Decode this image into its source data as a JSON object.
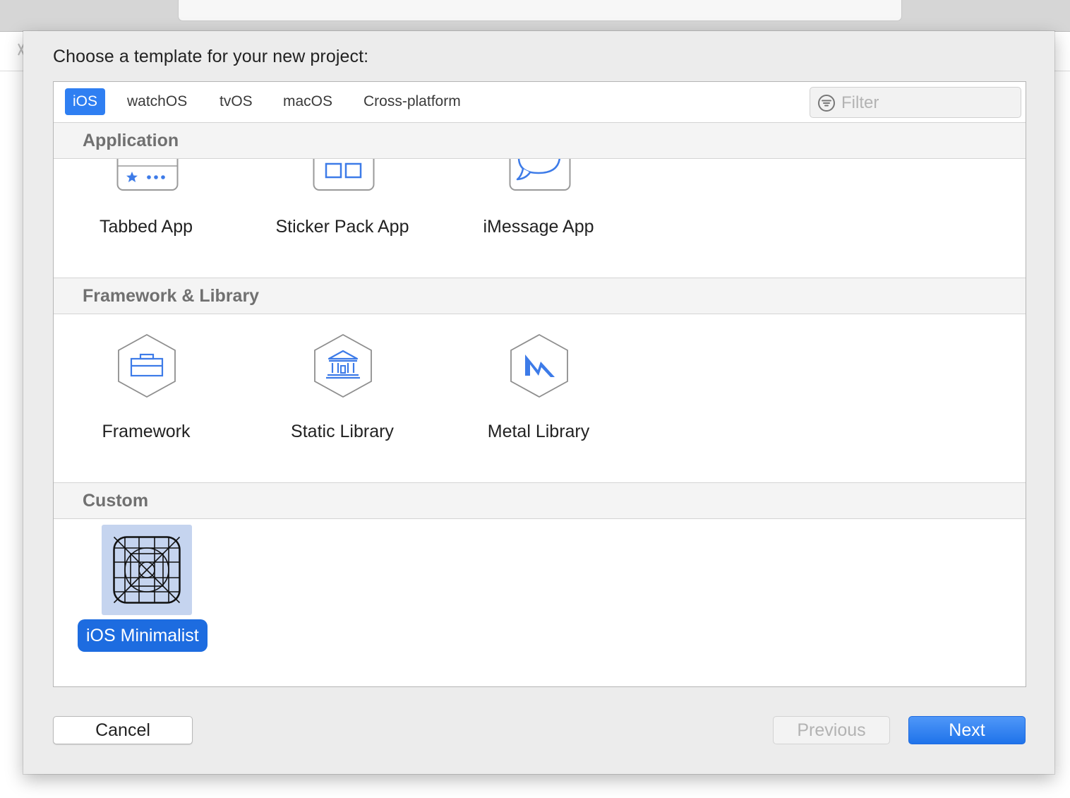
{
  "dialog": {
    "title": "Choose a template for your new project:"
  },
  "platform_tabs": [
    {
      "label": "iOS",
      "selected": true
    },
    {
      "label": "watchOS",
      "selected": false
    },
    {
      "label": "tvOS",
      "selected": false
    },
    {
      "label": "macOS",
      "selected": false
    },
    {
      "label": "Cross-platform",
      "selected": false
    }
  ],
  "filter": {
    "placeholder": "Filter",
    "icon": "filter-icon"
  },
  "sections": [
    {
      "title": "Application",
      "templates": [
        {
          "label": "Tabbed App",
          "icon": "tabbed-app-icon"
        },
        {
          "label": "Sticker Pack App",
          "icon": "sticker-pack-icon"
        },
        {
          "label": "iMessage App",
          "icon": "imessage-icon"
        }
      ]
    },
    {
      "title": "Framework & Library",
      "templates": [
        {
          "label": "Framework",
          "icon": "toolbox-icon"
        },
        {
          "label": "Static Library",
          "icon": "library-building-icon"
        },
        {
          "label": "Metal Library",
          "icon": "metal-icon"
        }
      ]
    },
    {
      "title": "Custom",
      "templates": [
        {
          "label": "iOS Minimalist",
          "icon": "app-icon-grid",
          "selected": true
        }
      ]
    }
  ],
  "buttons": {
    "cancel": "Cancel",
    "previous": "Previous",
    "next": "Next"
  },
  "colors": {
    "accent": "#2f7ff2",
    "selection": "#1d6ce0",
    "selection_bg": "#c5d4ef"
  }
}
